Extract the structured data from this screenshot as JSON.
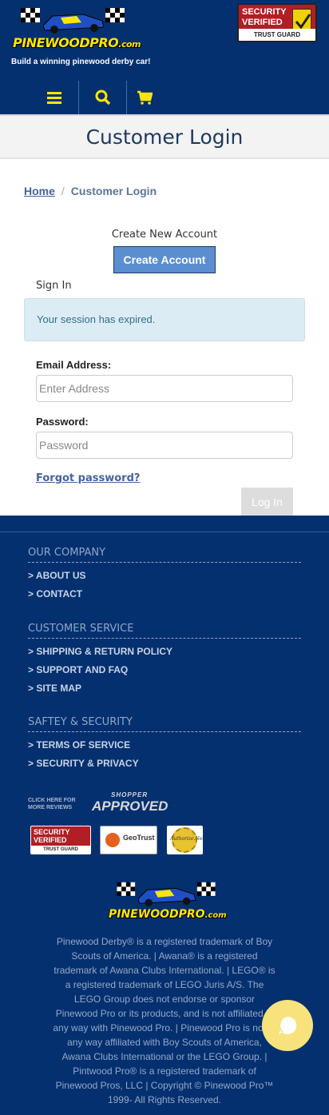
{
  "header": {
    "logo_text": "PINEWOODPRO",
    "logo_suffix": ".com",
    "tagline": "Build a winning pinewood derby car!",
    "trust_badge": {
      "line1": "SECURITY",
      "line2": "VERIFIED",
      "line3": "TRUST GUARD"
    },
    "nav_icons": [
      "menu-icon",
      "search-icon",
      "cart-icon"
    ],
    "accent": "#ffe600",
    "background": "#043070"
  },
  "page_title": "Customer Login",
  "breadcrumb": {
    "home": "Home",
    "separator": "/",
    "current": "Customer Login"
  },
  "account": {
    "create_label": "Create New Account",
    "create_button": "Create Account",
    "signin_label": "Sign In",
    "alert": "Your session has expired.",
    "email_label": "Email Address:",
    "email_placeholder": "Enter Address",
    "password_label": "Password:",
    "password_placeholder": "Password",
    "forgot": "Forgot password?",
    "login_button": "Log In"
  },
  "footer": {
    "sections": [
      {
        "title": "OUR COMPANY",
        "links": [
          "> ABOUT US",
          "> CONTACT"
        ]
      },
      {
        "title": "CUSTOMER SERVICE",
        "links": [
          "> SHIPPING & RETURN POLICY",
          "> SUPPORT AND FAQ",
          "> SITE MAP"
        ]
      },
      {
        "title": "SAFTEY & SECURITY",
        "links": [
          "> TERMS OF SERVICE",
          "> SECURITY & PRIVACY"
        ]
      }
    ],
    "shopper": {
      "click": "CLICK HERE FOR MORE REVIEWS",
      "top": "SHOPPER",
      "main": "APPROVED"
    },
    "seals": {
      "trust_line1": "SECURITY",
      "trust_line2": "VERIFIED",
      "trust_line3": "TRUST GUARD",
      "geotrust": "GeoTrust",
      "authorize": "Authorize.Net"
    },
    "logo_text": "PINEWOODPRO",
    "logo_suffix": ".com",
    "disclaimer": "Pinewood Derby® is a registered trademark of Boy Scouts of America. | Awana® is a registered trademark of Awana Clubs International. | LEGO® is a registered trademark of LEGO Juris A/S. The LEGO Group does not endorse or sponsor Pinewood Pro or its products, and is not affiliated in any way with Pinewood Pro. | Pinewood Pro is not in any way affiliated with Boy Scouts of America, Awana Clubs International or the LEGO Group. | Pintwood Pro® is a registered trademark of Pinewood Pros, LLC | Copyright © Pinewood Pro™ 1999- All Rights Reserved."
  }
}
